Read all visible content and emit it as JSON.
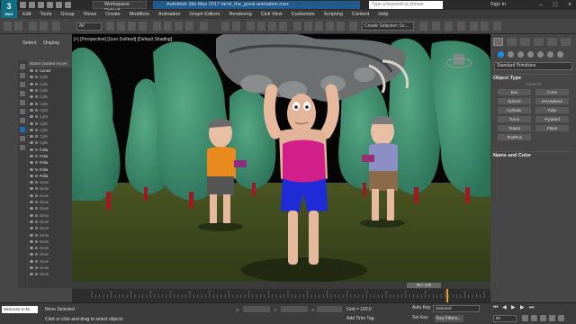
{
  "titlebar": {
    "logo": "3",
    "logo_sub": "MAX",
    "workspace": "Workspace: Default",
    "title": "Autodesk 3ds Max 2017    tamil_the_great animation.max",
    "search_placeholder": "Type a keyword or phrase",
    "signin": "Sign In"
  },
  "menu": [
    "Edit",
    "Tools",
    "Group",
    "Views",
    "Create",
    "Modifiers",
    "Animation",
    "Graph Editors",
    "Rendering",
    "Civil View",
    "Customize",
    "Scripting",
    "Content",
    "Help"
  ],
  "toolbar": {
    "filter": "All",
    "selection_set": "Create Selection Se..."
  },
  "scene_explorer": {
    "tabs": [
      "Select",
      "Display"
    ],
    "header": "Name (Sorted Ascen",
    "rows": [
      {
        "name": "Cone0",
        "bright": true
      },
      {
        "name": "Cylin",
        "bright": false
      },
      {
        "name": "Cylin",
        "bright": false
      },
      {
        "name": "Cylin",
        "bright": false
      },
      {
        "name": "Cylin",
        "bright": false
      },
      {
        "name": "Cylin",
        "bright": false
      },
      {
        "name": "Cylin",
        "bright": false
      },
      {
        "name": "Cylin",
        "bright": false
      },
      {
        "name": "Cylin",
        "bright": false
      },
      {
        "name": "Cylin",
        "bright": false
      },
      {
        "name": "Cylin",
        "bright": false
      },
      {
        "name": "Cylin",
        "bright": false
      },
      {
        "name": "Folia",
        "bright": true
      },
      {
        "name": "Folia",
        "bright": true
      },
      {
        "name": "Folia",
        "bright": true
      },
      {
        "name": "Folia",
        "bright": true
      },
      {
        "name": "Folia",
        "bright": true
      },
      {
        "name": "Geos",
        "bright": false
      },
      {
        "name": "Geos",
        "bright": false
      },
      {
        "name": "Geos",
        "bright": false
      },
      {
        "name": "Geos",
        "bright": false
      },
      {
        "name": "Geos",
        "bright": false
      },
      {
        "name": "Geos",
        "bright": false
      },
      {
        "name": "Geos",
        "bright": false
      },
      {
        "name": "Geos",
        "bright": false
      },
      {
        "name": "Geos",
        "bright": false
      },
      {
        "name": "Geos",
        "bright": false
      },
      {
        "name": "Geos",
        "bright": false
      },
      {
        "name": "Geos",
        "bright": false
      },
      {
        "name": "Geos",
        "bright": false
      },
      {
        "name": "Geos",
        "bright": false
      },
      {
        "name": "Geos",
        "bright": false
      }
    ]
  },
  "viewport": {
    "label": "[+] [Perspective] [User Defined] [Default Shading]"
  },
  "command_panel": {
    "dropdown": "Standard Primitives",
    "object_type_title": "Object Type",
    "autogrid": "AutoGrid",
    "buttons": [
      "Box",
      "Cone",
      "Sphere",
      "GeoSphere",
      "Cylinder",
      "Tube",
      "Torus",
      "Pyramid",
      "Teapot",
      "Plane",
      "TextPlus"
    ],
    "name_color_title": "Name and Color"
  },
  "timeline": {
    "frame_display": "90 / 100"
  },
  "status": {
    "maxscript": "Welcome to M",
    "selection": "None Selected",
    "hint": "Click or click-and-drag to select objects",
    "x_label": "X:",
    "y_label": "Y:",
    "z_label": "Z:",
    "grid": "Grid = 100,0",
    "add_time_tag": "Add Time Tag",
    "auto_key": "Auto Key",
    "set_key": "Set Key",
    "selected_dropdown": "Selected",
    "key_filters": "Key Filters...",
    "frame": "90"
  },
  "colors": {
    "accent": "#1e6db5",
    "title_bg": "#1f5b8f",
    "logo": "#0e6f84"
  }
}
